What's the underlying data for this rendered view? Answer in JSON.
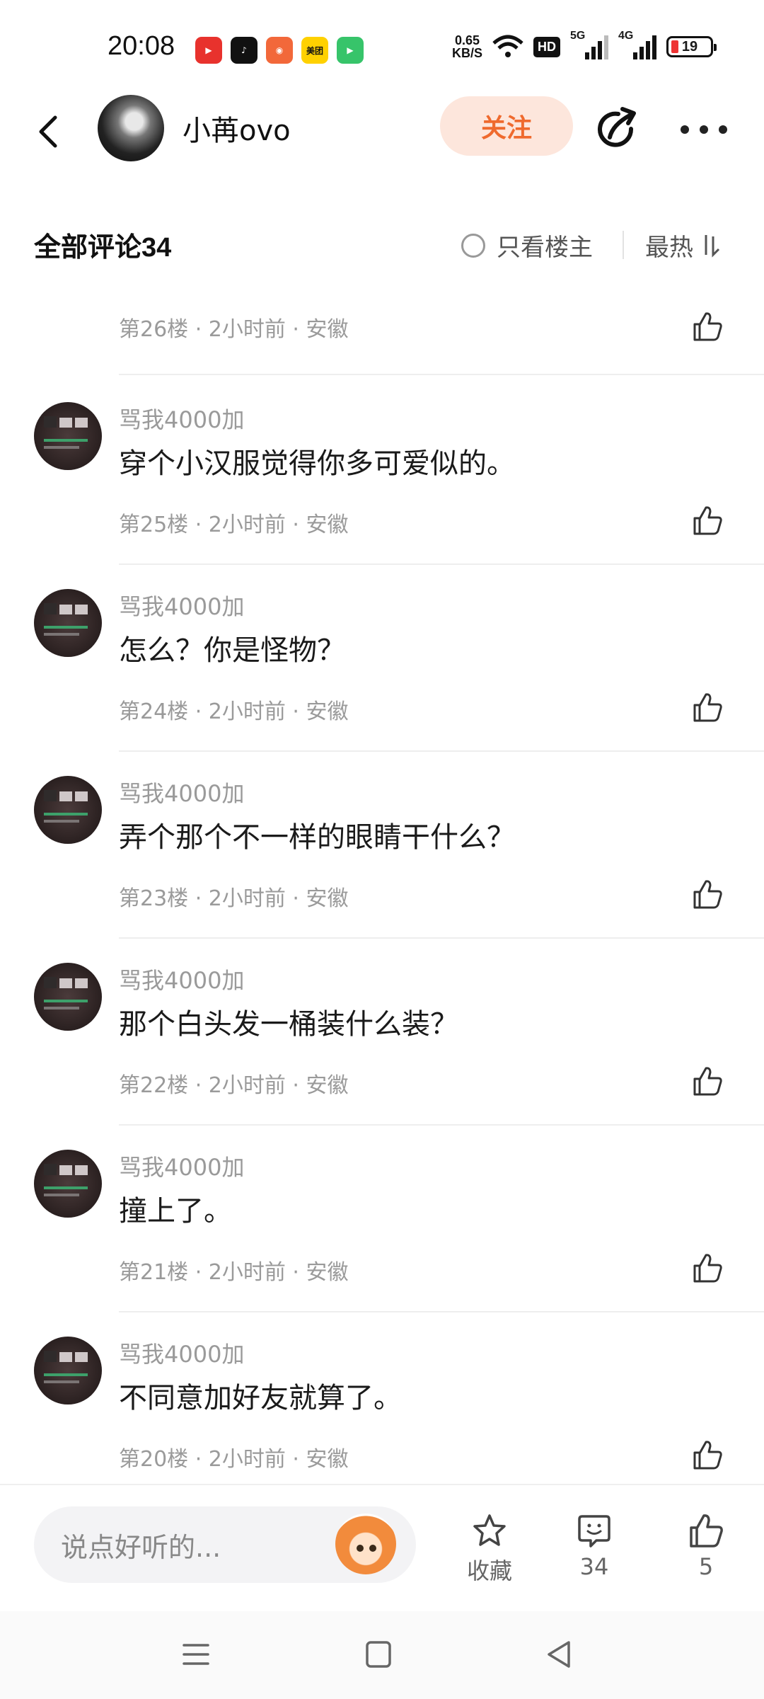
{
  "status_bar": {
    "time": "20:08",
    "apps": [
      {
        "icon": "video-app-icon",
        "color": "#e8322d"
      },
      {
        "icon": "tiktok-icon",
        "color": "#111111"
      },
      {
        "icon": "game-app-icon",
        "color": "#f2683a"
      },
      {
        "icon": "meituan-icon",
        "color": "#ffd100",
        "label": "美团"
      },
      {
        "icon": "video-player-icon",
        "color": "#37c46a"
      }
    ],
    "net_speed_value": "0.65",
    "net_speed_unit": "KB/S",
    "hd_label": "HD",
    "net1": "5G",
    "net2": "4G",
    "battery": "19"
  },
  "header": {
    "username": "小苒ovo",
    "follow_label": "关注"
  },
  "comments_header": {
    "title": "全部评论",
    "count": "34",
    "only_op_label": "只看楼主",
    "sort_label": "最热"
  },
  "partial_floor": "第26楼 · 2小时前 · 安徽",
  "comments": [
    {
      "name": "骂我4000加",
      "text": "穿个小汉服觉得你多可爱似的。",
      "floor": "第25楼 · 2小时前 · 安徽"
    },
    {
      "name": "骂我4000加",
      "text": "怎么？你是怪物？",
      "floor": "第24楼 · 2小时前 · 安徽"
    },
    {
      "name": "骂我4000加",
      "text": "弄个那个不一样的眼睛干什么？",
      "floor": "第23楼 · 2小时前 · 安徽"
    },
    {
      "name": "骂我4000加",
      "text": "那个白头发一桶装什么装？",
      "floor": "第22楼 · 2小时前 · 安徽"
    },
    {
      "name": "骂我4000加",
      "text": "撞上了。",
      "floor": "第21楼 · 2小时前 · 安徽"
    },
    {
      "name": "骂我4000加",
      "text": "不同意加好友就算了。",
      "floor": "第20楼 · 2小时前 · 安徽"
    }
  ],
  "bottom_bar": {
    "input_placeholder": "说点好听的...",
    "favorite_label": "收藏",
    "comment_count": "34",
    "like_count": "5"
  },
  "colors": {
    "accent": "#ef6a2e",
    "follow_bg": "#fde6dc",
    "muted_text": "#9a9a9a"
  }
}
